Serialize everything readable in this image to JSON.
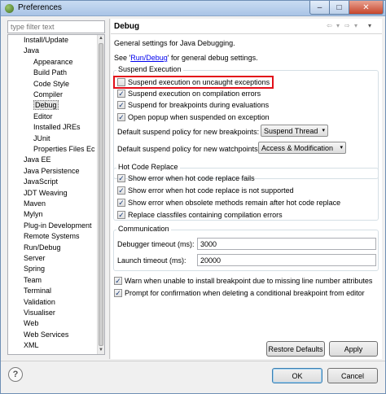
{
  "window": {
    "title": "Preferences",
    "minimize": "–",
    "maximize": "□",
    "close": "✕",
    "colors": {
      "titlebar": "#a9c4e6",
      "close": "#c7452b",
      "highlight": "#e2101a",
      "link": "#0000ee"
    }
  },
  "filter": {
    "placeholder": "type filter text"
  },
  "tree": {
    "items": [
      {
        "label": "Install/Update",
        "level": 1
      },
      {
        "label": "Java",
        "level": 1
      },
      {
        "label": "Appearance",
        "level": 2
      },
      {
        "label": "Build Path",
        "level": 2
      },
      {
        "label": "Code Style",
        "level": 2
      },
      {
        "label": "Compiler",
        "level": 2
      },
      {
        "label": "Debug",
        "level": 2,
        "selected": true
      },
      {
        "label": "Editor",
        "level": 2
      },
      {
        "label": "Installed JREs",
        "level": 2
      },
      {
        "label": "JUnit",
        "level": 2
      },
      {
        "label": "Properties Files Ec",
        "level": 2
      },
      {
        "label": "Java EE",
        "level": 1
      },
      {
        "label": "Java Persistence",
        "level": 1
      },
      {
        "label": "JavaScript",
        "level": 1
      },
      {
        "label": "JDT Weaving",
        "level": 1
      },
      {
        "label": "Maven",
        "level": 1
      },
      {
        "label": "Mylyn",
        "level": 1
      },
      {
        "label": "Plug-in Development",
        "level": 1
      },
      {
        "label": "Remote Systems",
        "level": 1
      },
      {
        "label": "Run/Debug",
        "level": 1
      },
      {
        "label": "Server",
        "level": 1
      },
      {
        "label": "Spring",
        "level": 1
      },
      {
        "label": "Team",
        "level": 1
      },
      {
        "label": "Terminal",
        "level": 1
      },
      {
        "label": "Validation",
        "level": 1
      },
      {
        "label": "Visualiser",
        "level": 1
      },
      {
        "label": "Web",
        "level": 1
      },
      {
        "label": "Web Services",
        "level": 1
      },
      {
        "label": "XML",
        "level": 1
      }
    ]
  },
  "page": {
    "title": "Debug",
    "nav": {
      "back": "⇦",
      "back_menu": "▾",
      "forward": "⇨",
      "forward_menu": "▾",
      "view_menu": "▾"
    },
    "description": "General settings for Java Debugging.",
    "see_prefix": "See '",
    "see_link": "Run/Debug",
    "see_suffix": "' for general debug settings.",
    "suspend_group": {
      "label": "Suspend Execution",
      "options": [
        {
          "label": "Suspend execution on uncaught exceptions",
          "checked": false
        },
        {
          "label": "Suspend execution on compilation errors",
          "checked": true
        },
        {
          "label": "Suspend for breakpoints during evaluations",
          "checked": true
        },
        {
          "label": "Open popup when suspended on exception",
          "checked": true
        }
      ],
      "breakpoint_policy_label": "Default suspend policy for new breakpoints:",
      "breakpoint_policy_value": "Suspend Thread",
      "watchpoint_policy_label": "Default suspend policy for new watchpoints:",
      "watchpoint_policy_value": "Access & Modification"
    },
    "hcr_group": {
      "label": "Hot Code Replace",
      "options": [
        {
          "label": "Show error when hot code replace fails",
          "checked": true
        },
        {
          "label": "Show error when hot code replace is not supported",
          "checked": true
        },
        {
          "label": "Show error when obsolete methods remain after hot code replace",
          "checked": true
        },
        {
          "label": "Replace classfiles containing compilation errors",
          "checked": true
        }
      ]
    },
    "comm_group": {
      "label": "Communication",
      "debugger_timeout_label": "Debugger timeout (ms):",
      "debugger_timeout_value": "3000",
      "launch_timeout_label": "Launch timeout (ms):",
      "launch_timeout_value": "20000"
    },
    "extra_options": [
      {
        "label": "Warn when unable to install breakpoint due to missing line number attributes",
        "checked": true
      },
      {
        "label": "Prompt for confirmation when deleting a conditional breakpoint from editor",
        "checked": true
      }
    ],
    "restore_defaults": "Restore Defaults",
    "apply": "Apply"
  },
  "footer": {
    "help": "?",
    "ok": "OK",
    "cancel": "Cancel"
  },
  "check_mark": "✓",
  "caret": "▾"
}
